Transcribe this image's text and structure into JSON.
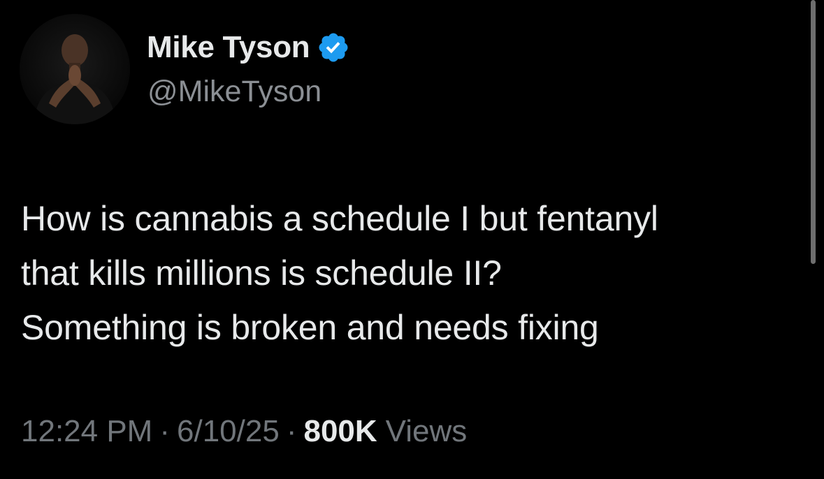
{
  "author": {
    "display_name": "Mike Tyson",
    "handle": "@MikeTyson",
    "verified_color": "#1d9bf0"
  },
  "tweet": {
    "text": "How is cannabis a schedule I but fentanyl\nthat kills millions is schedule II?\nSomething is broken and needs fixing"
  },
  "meta": {
    "time": "12:24 PM",
    "separator": "·",
    "date": "6/10/25",
    "views_count": "800K",
    "views_label": "Views"
  },
  "colors": {
    "background": "#000000",
    "primary_text": "#e7e9ea",
    "secondary_text": "#71767b"
  }
}
